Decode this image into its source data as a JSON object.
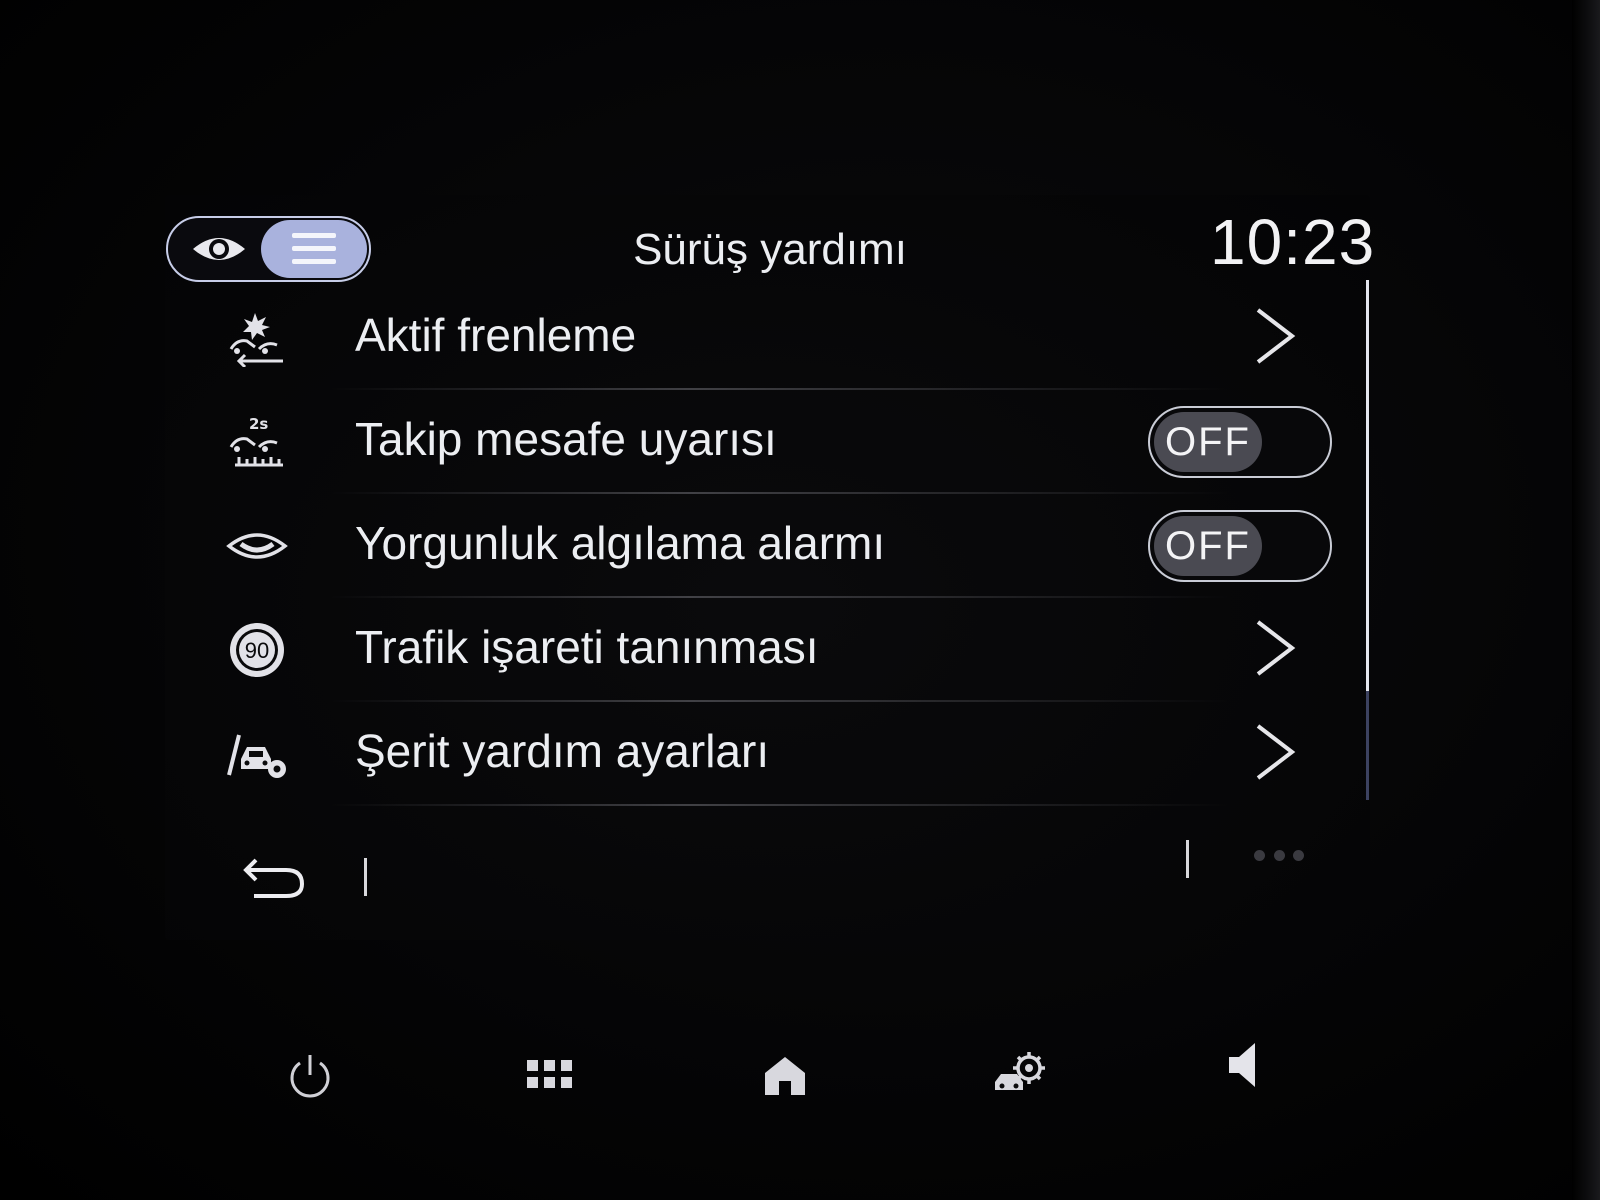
{
  "header": {
    "title": "Sürüş yardımı",
    "clock": "10:23",
    "mode_toggle": {
      "options": [
        "eye-icon",
        "list-icon"
      ],
      "selected": "list-icon"
    }
  },
  "menu": {
    "items": [
      {
        "label": "Aktif frenleme",
        "icon": "active-braking-icon",
        "control": "chevron"
      },
      {
        "label": "Takip mesafe uyarısı",
        "icon": "distance-warning-icon",
        "control": "toggle",
        "state": "OFF"
      },
      {
        "label": "Yorgunluk algılama alarmı",
        "icon": "fatigue-eye-icon",
        "control": "toggle",
        "state": "OFF"
      },
      {
        "label": "Trafik işareti tanınması",
        "icon": "speed-sign-icon",
        "icon_text": "90",
        "control": "chevron"
      },
      {
        "label": "Şerit yardım ayarları",
        "icon": "lane-assist-icon",
        "control": "chevron"
      }
    ]
  },
  "scrollbar": {
    "visible_fraction": 0.79
  },
  "action_bar": {
    "back": "back-arrow-icon",
    "more": "more-dots-icon"
  },
  "hardware_bar": [
    "power-icon",
    "apps-grid-icon",
    "home-icon",
    "driving-settings-icon",
    "volume-icon"
  ],
  "colors": {
    "accent": "#a9b2dd",
    "text": "#eceef2",
    "background": "#000000",
    "toggle_knob": "#4a4a52"
  }
}
